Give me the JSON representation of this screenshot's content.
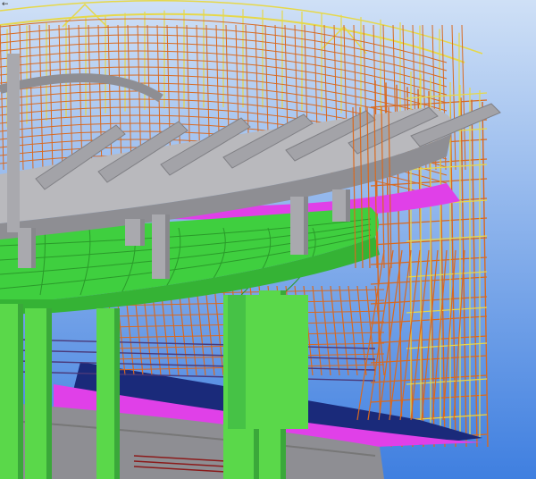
{
  "viewport": {
    "background_top": "#cfe0f6",
    "background_bottom": "#3f7fe0"
  },
  "colors": {
    "scaffold_orange": "#d9691f",
    "scaffold_yellow": "#e6d84a",
    "slab_gray": "#8e8e93",
    "slab_gray_light": "#b9b9bd",
    "column_gray": "#a9a9ae",
    "slab_green": "#3fcf3f",
    "column_green": "#5ad84a",
    "platform_magenta": "#e040e8",
    "platform_navy": "#1a2a7a",
    "rail_dark": "#4a3a7a"
  },
  "icons": {
    "corner_arrow": "arrow-left-icon"
  },
  "corner_arrow_glyph": "←"
}
